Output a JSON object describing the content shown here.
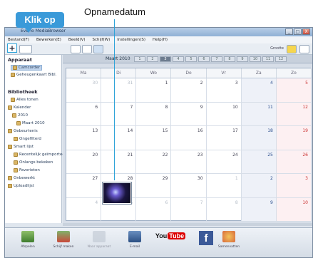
{
  "annotations": {
    "click_label": "Klik op",
    "date_label": "Opnamedatum"
  },
  "window": {
    "title": "Everio MediaBrowser",
    "buttons": [
      "_",
      "□",
      "X"
    ]
  },
  "menu": [
    "Bestand(F)",
    "Bewerken(E)",
    "Beeld(V)",
    "Schijf(W)",
    "Instellingen(S)",
    "Help(H)"
  ],
  "toolbar": {
    "add_symbol": "+",
    "size_label": "Grootte"
  },
  "sidebar": {
    "header_device": "Apparaat",
    "device_items": [
      "Camcorder",
      "Geheugenkaart Bibl."
    ],
    "header_library": "Bibliotheek",
    "library_items": [
      "Alles tonen",
      "Kalender",
      "2010",
      "Maart 2010",
      "Gebeurtenis",
      "Ongefilterd",
      "Smart lijst",
      "Recentelijk geïmporteerd",
      "Onlangs bekeken",
      "Favorieten",
      "Onbewerkt",
      "Uploadlijst"
    ]
  },
  "calendar": {
    "month_title": "Maart 2010",
    "months": [
      "1",
      "2",
      "3",
      "4",
      "5",
      "6",
      "7",
      "8",
      "9",
      "10",
      "11",
      "12"
    ],
    "selected_month": "3",
    "days": [
      "Ma",
      "Di",
      "Wo",
      "Do",
      "Vr",
      "Za",
      "Zo"
    ],
    "weeks": [
      [
        "30",
        "31",
        "1",
        "2",
        "3",
        "4",
        "5"
      ],
      [
        "6",
        "7",
        "8",
        "9",
        "10",
        "11",
        "12"
      ],
      [
        "13",
        "14",
        "15",
        "16",
        "17",
        "18",
        "19"
      ],
      [
        "20",
        "21",
        "22",
        "23",
        "24",
        "25",
        "26"
      ],
      [
        "27",
        "28",
        "29",
        "30",
        "1",
        "2",
        "3"
      ],
      [
        "4",
        "5",
        "6",
        "7",
        "8",
        "9",
        "10"
      ]
    ]
  },
  "bottom": [
    {
      "label": "Afspelen",
      "icon": "play-icon"
    },
    {
      "label": "Schijf maken",
      "icon": "disc-create-icon"
    },
    {
      "label": "Naar apparaat",
      "icon": "device-export-icon"
    },
    {
      "label": "E-mail",
      "icon": "email-icon"
    },
    {
      "label": "YouTube",
      "icon": "youtube-icon"
    },
    {
      "label": "Facebook",
      "icon": "facebook-icon"
    },
    {
      "label": "Samenvatten",
      "icon": "summary-icon"
    }
  ]
}
